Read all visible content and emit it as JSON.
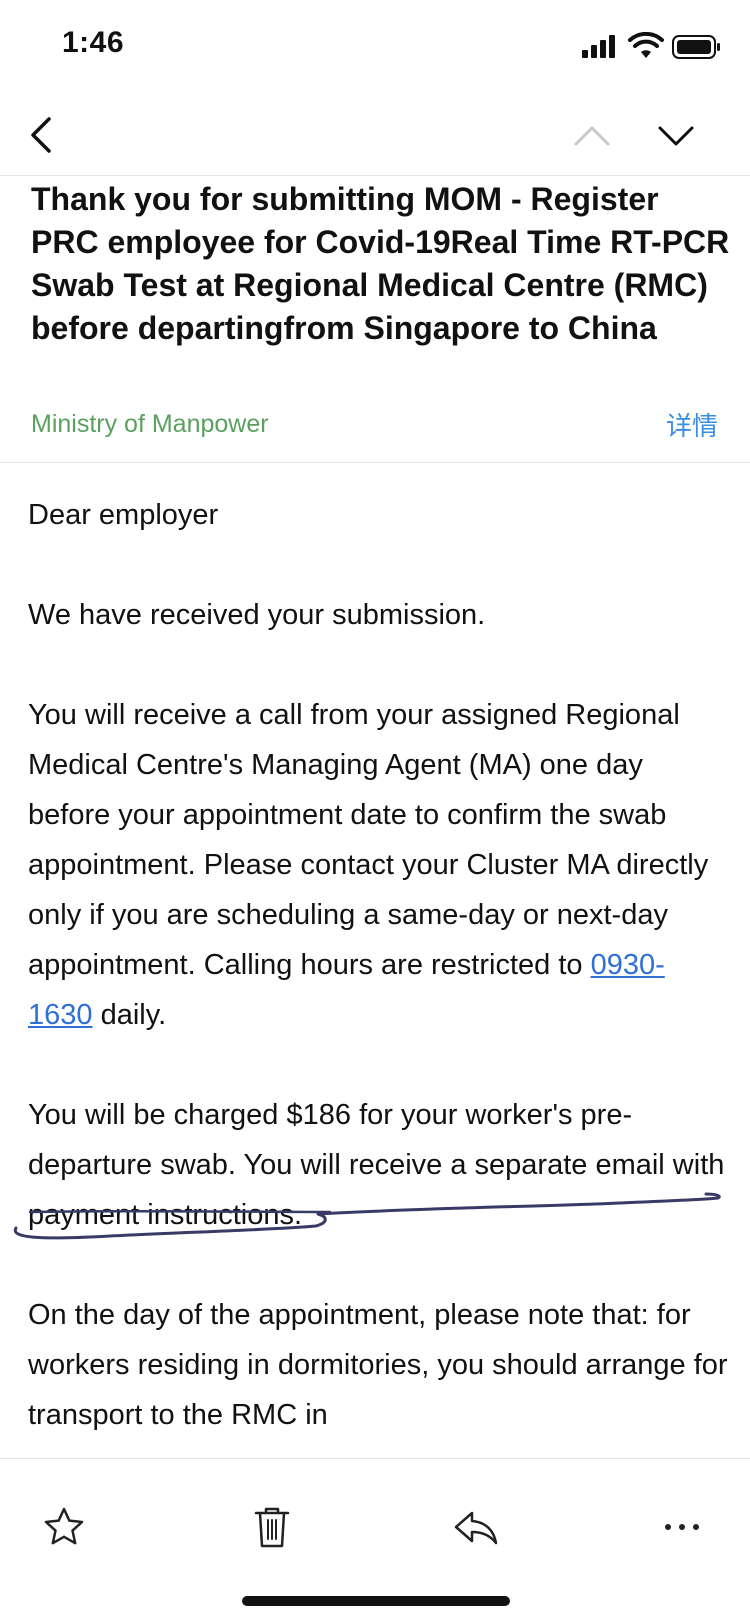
{
  "status_bar": {
    "time": "1:46",
    "icons": [
      "cellular-signal-icon",
      "wifi-icon",
      "battery-icon"
    ]
  },
  "nav": {
    "back_icon": "chevron-left-icon",
    "prev_icon": "chevron-up-icon",
    "next_icon": "chevron-down-icon"
  },
  "email": {
    "subject": "Thank you for submitting MOM - Register PRC employee for Covid-19Real Time RT-PCR Swab Test at Regional Medical Centre (RMC) before departingfrom Singapore to China",
    "sender": "Ministry of Manpower",
    "details_label": "详情",
    "greeting": "Dear employer",
    "paragraph_received": "We have received your submission.",
    "paragraph_call": "You will receive a call from your assigned Regional Medical Centre's Managing Agent (MA) one day before your appointment date to confirm the swab appointment. Please contact your Cluster MA directly only if you are scheduling a same-day or next-day appointment. Calling hours are restricted to",
    "calling_hours_link": "0930-1630",
    "calling_hours_suffix": " daily.",
    "paragraph_charge": "You will be charged $186 for your worker's pre-departure swab. You will receive a separate email with payment instructions.",
    "paragraph_day_of": "On the day of the appointment, please note that: for workers residing in dormitories, you should arrange for transport to the RMC in"
  },
  "colors": {
    "sender": "#5aa05f",
    "link": "#3a8ee6",
    "phone_link": "#2f6fd6",
    "ink_mark": "#3a3a66"
  },
  "toolbar": {
    "icons": [
      "star-icon",
      "trash-icon",
      "reply-icon",
      "more-icon"
    ]
  }
}
